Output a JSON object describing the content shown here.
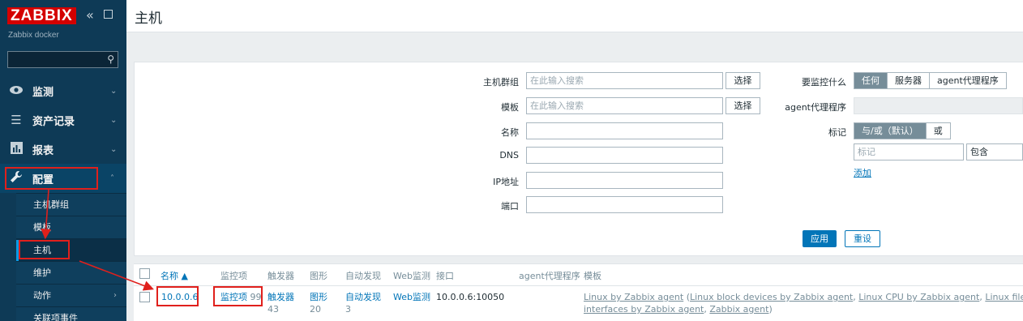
{
  "sidebar": {
    "logo": "ZABBIX",
    "collapse_icon": "«",
    "server_name": "Zabbix docker",
    "menu": [
      {
        "label": "监测",
        "icon": "eye-icon"
      },
      {
        "label": "资产记录",
        "icon": "list-icon"
      },
      {
        "label": "报表",
        "icon": "chart-icon"
      },
      {
        "label": "配置",
        "icon": "wrench-icon"
      }
    ],
    "submenu": [
      "主机群组",
      "模板",
      "主机",
      "维护",
      "动作",
      "关联项事件"
    ]
  },
  "header": {
    "title": "主机"
  },
  "filter": {
    "host_groups_label": "主机群组",
    "host_groups_placeholder": "在此输入搜索",
    "templates_label": "模板",
    "templates_placeholder": "在此输入搜索",
    "select_label": "选择",
    "name_label": "名称",
    "dns_label": "DNS",
    "ip_label": "IP地址",
    "port_label": "端口",
    "monitored_by_label": "要监控什么",
    "monitored_by_options": [
      "任何",
      "服务器",
      "agent代理程序"
    ],
    "proxy_label": "agent代理程序",
    "tags_label": "标记",
    "tags_mode_options": [
      "与/或（默认）",
      "或"
    ],
    "tag_placeholder": "标记",
    "tag_operator": "包含",
    "add_label": "添加",
    "apply_label": "应用",
    "reset_label": "重设"
  },
  "table": {
    "columns": [
      "名称 ▲",
      "监控项",
      "触发器",
      "图形",
      "自动发现",
      "Web监测",
      "接口",
      "agent代理程序",
      "模板"
    ],
    "row": {
      "name": "10.0.0.6",
      "items_label": "监控项",
      "items_count": "99",
      "triggers_label_1": "触发",
      "triggers_label_2": "器",
      "triggers_count": "43",
      "graphs_label_1": "图",
      "graphs_label_2": "形",
      "graphs_count": "20",
      "discovery_label_1": "自动发",
      "discovery_label_2": "现",
      "discovery_count": "3",
      "web_label": "Web监测",
      "interface": "10.0.0.6:10050",
      "templates_line1_a": "Linux by Zabbix agent",
      "templates_line1_b": " (",
      "templates_line1_c": "Linux block devices by Zabbix agent",
      "templates_line1_d": ", ",
      "templates_line1_e": "Linux CPU by Zabbix agent",
      "templates_line1_f": ", ",
      "templates_line1_g": "Linux filesystems by Zab",
      "templates_line2_a": "interfaces by Zabbix agent",
      "templates_line2_b": ", ",
      "templates_line2_c": "Zabbix agent",
      "templates_line2_d": ")"
    }
  },
  "colors": {
    "annotation": "#e0201c",
    "link": "#0275b8",
    "sidebar": "#0e3a56",
    "logo": "#d40000"
  }
}
